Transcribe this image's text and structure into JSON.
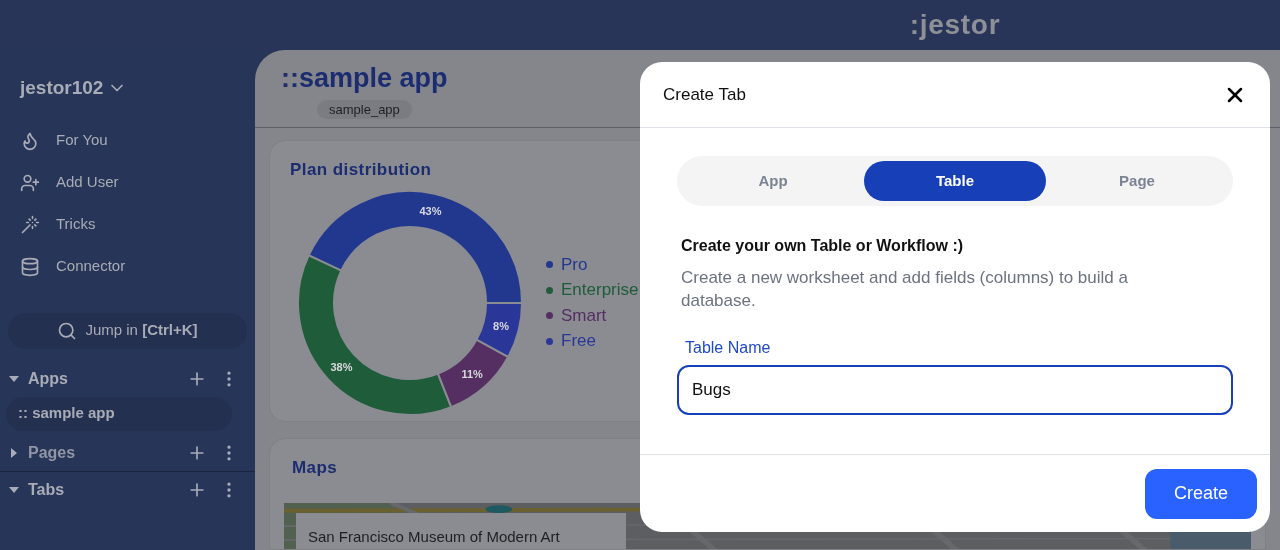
{
  "topbar": {
    "logo": ":jestor"
  },
  "sidebar": {
    "workspace": "jestor102",
    "nav": [
      {
        "label": "For You",
        "kind": "flame"
      },
      {
        "label": "Add User",
        "kind": "user-plus"
      },
      {
        "label": "Tricks",
        "kind": "hat"
      },
      {
        "label": "Connector",
        "kind": "database"
      }
    ],
    "search": "Jump in **[Ctrl+K]**",
    "sections": [
      {
        "label": "Apps",
        "expanded": true,
        "items": [
          {
            "label": ":: sample app",
            "selected": true
          }
        ]
      },
      {
        "label": "Pages",
        "expanded": false
      },
      {
        "label": "Tabs",
        "expanded": true
      }
    ]
  },
  "main": {
    "title": "::sample app",
    "slug": "sample_app",
    "plan_card": {
      "title": "Plan distribution",
      "legend": [
        {
          "color": "#22388f"
        },
        {
          "color": "#1f5c3a"
        },
        {
          "color": "#552e62"
        },
        {
          "color": "#2a3799"
        }
      ],
      "chart_data": {
        "type": "donut",
        "categories": [
          "Pro",
          "Enterprise",
          "Smart",
          "Free"
        ],
        "values": [
          43,
          38,
          11,
          8
        ],
        "value_labels": [
          "43%",
          "38%",
          "11%",
          "8%"
        ]
      }
    },
    "maps_card": {
      "title": "Maps",
      "place": "San Francisco Museum of Modern Art"
    }
  },
  "modal": {
    "title": "Create Tab",
    "tabs": [
      {
        "label": "App",
        "selected": false
      },
      {
        "label": "Table",
        "selected": true
      },
      {
        "label": "Page",
        "selected": false
      }
    ],
    "heading": "Create your own Table or Workflow :)",
    "description": "Create a new worksheet and add fields (columns) to build a database.",
    "field": {
      "label": "Table Name",
      "value": "Bugs"
    },
    "button": "Create"
  }
}
